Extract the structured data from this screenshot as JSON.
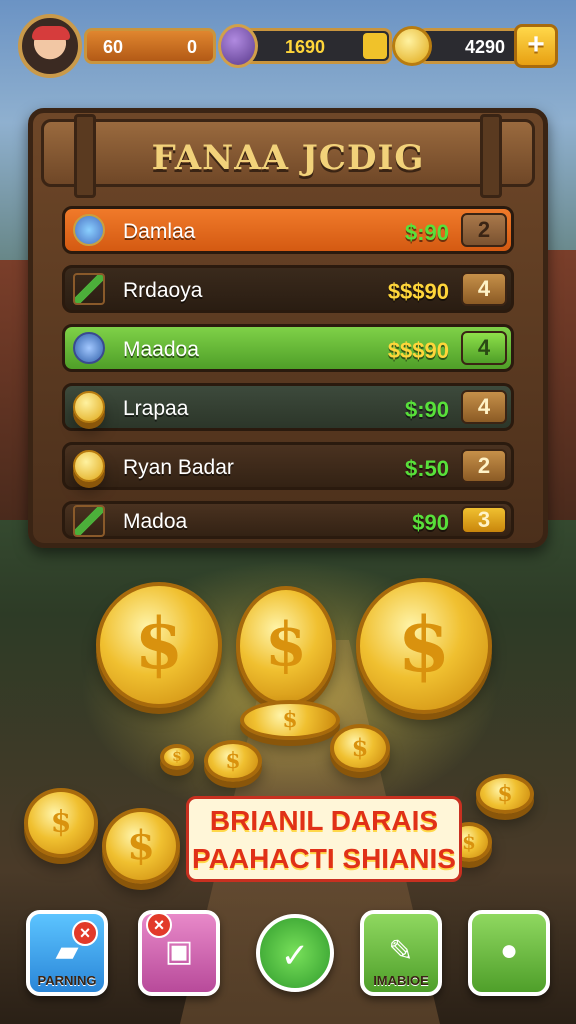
{
  "hud": {
    "stat_left": "60",
    "stat_right": "0",
    "gems": "1690",
    "coins": "4290",
    "plus_label": "+"
  },
  "board": {
    "title": "FANAA JCDIG",
    "rows": [
      {
        "name": "Damlaa",
        "price": "$:90",
        "count": "2",
        "price_color": "#58e03a"
      },
      {
        "name": "Rrdaoya",
        "price": "$$$90",
        "count": "4",
        "price_color": "#ffd63a"
      },
      {
        "name": "Maadoa",
        "price": "$$$90",
        "count": "4",
        "price_color": "#ffd63a"
      },
      {
        "name": "Lrapaa",
        "price": "$:90",
        "count": "4",
        "price_color": "#58e03a"
      },
      {
        "name": "Ryan Badar",
        "price": "$:50",
        "count": "2",
        "price_color": "#58e03a"
      },
      {
        "name": "Madoa",
        "price": "$90",
        "count": "3",
        "price_color": "#58e03a"
      }
    ]
  },
  "banner": {
    "line1": "BRIANIL DARAIS",
    "line2": "PAAHACTI SHIANIS"
  },
  "bottom_nav": {
    "btn1_label": "PARNING",
    "btn1_badge": "×",
    "btn2_badge": "×",
    "btn3_glyph": "✓",
    "btn4_label": "IMABIOE"
  },
  "colors": {
    "accent_gold": "#f0c030",
    "wood": "#6e4728",
    "banner_red": "#e03018"
  }
}
